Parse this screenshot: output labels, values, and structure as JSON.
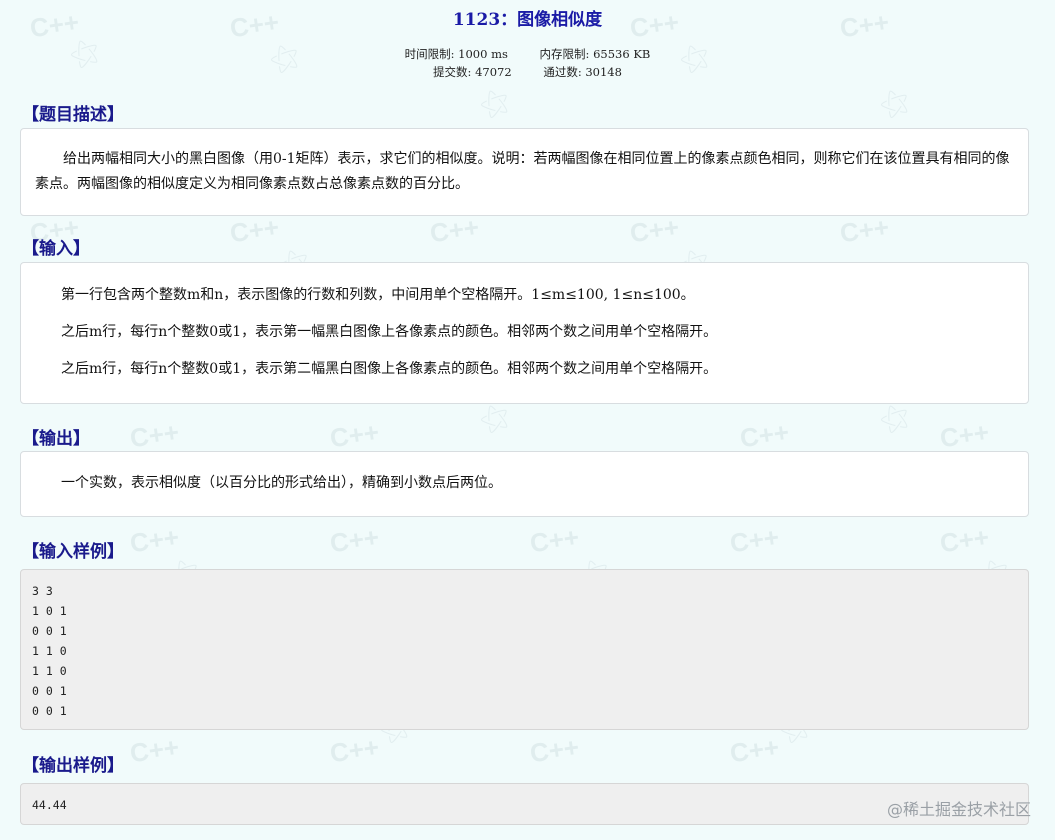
{
  "problem": {
    "id": "1123",
    "separator": "：",
    "name": "图像相似度"
  },
  "meta": {
    "time_limit_label": "时间限制:",
    "time_limit_value": "1000 ms",
    "memory_limit_label": "内存限制:",
    "memory_limit_value": "65536 KB",
    "submissions_label": "提交数:",
    "submissions_value": "47072",
    "accepted_label": "通过数:",
    "accepted_value": "30148"
  },
  "sections": {
    "description": {
      "heading": "【题目描述】",
      "text": "给出两幅相同大小的黑白图像（用0-1矩阵）表示，求它们的相似度。说明：若两幅图像在相同位置上的像素点颜色相同，则称它们在该位置具有相同的像素点。两幅图像的相似度定义为相同像素点数占总像素点数的百分比。"
    },
    "input": {
      "heading": "【输入】",
      "lines": [
        "第一行包含两个整数m和n，表示图像的行数和列数，中间用单个空格隔开。1≤m≤100, 1≤n≤100。",
        "之后m行，每行n个整数0或1，表示第一幅黑白图像上各像素点的颜色。相邻两个数之间用单个空格隔开。",
        "之后m行，每行n个整数0或1，表示第二幅黑白图像上各像素点的颜色。相邻两个数之间用单个空格隔开。"
      ]
    },
    "output": {
      "heading": "【输出】",
      "text": "一个实数，表示相似度（以百分比的形式给出），精确到小数点后两位。"
    },
    "sample_input": {
      "heading": "【输入样例】",
      "lines": [
        "3 3",
        "1 0 1",
        "0 0 1",
        "1 1 0",
        "1 1 0",
        "0 0 1",
        "0 0 1"
      ]
    },
    "sample_output": {
      "heading": "【输出样例】",
      "lines": [
        "44.44"
      ]
    }
  },
  "watermark": {
    "text": "C++",
    "site_mark": "@稀土掘金技术社区"
  },
  "colors": {
    "background": "#f1fbfb",
    "title": "#1a1aa6",
    "heading": "#1a1a8c",
    "panel": "#ffffff",
    "code_bg": "#efefef"
  }
}
